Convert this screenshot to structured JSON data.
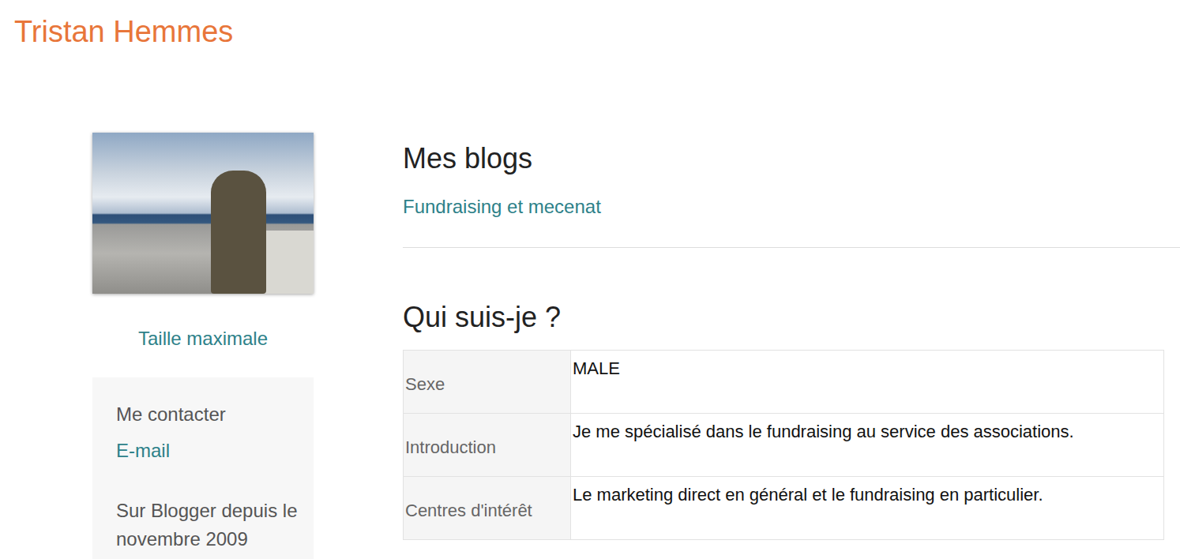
{
  "blog_title": "Tristan Hemmes",
  "sidebar": {
    "photo_link": "Taille maximale",
    "contact": {
      "heading": "Me contacter",
      "email": "E-mail"
    },
    "member_since": "Sur Blogger depuis le novembre 2009"
  },
  "blogs": {
    "heading": "Mes blogs",
    "items": [
      "Fundraising et mecenat"
    ]
  },
  "about": {
    "heading": "Qui suis-je ?",
    "rows": [
      {
        "label": "Sexe",
        "value": "MALE"
      },
      {
        "label": "Introduction",
        "value": "Je me spécialisé dans le fundraising au service des associations."
      },
      {
        "label": "Centres d'intérêt",
        "value": "Le marketing direct en général et le fundraising en particulier."
      }
    ]
  }
}
